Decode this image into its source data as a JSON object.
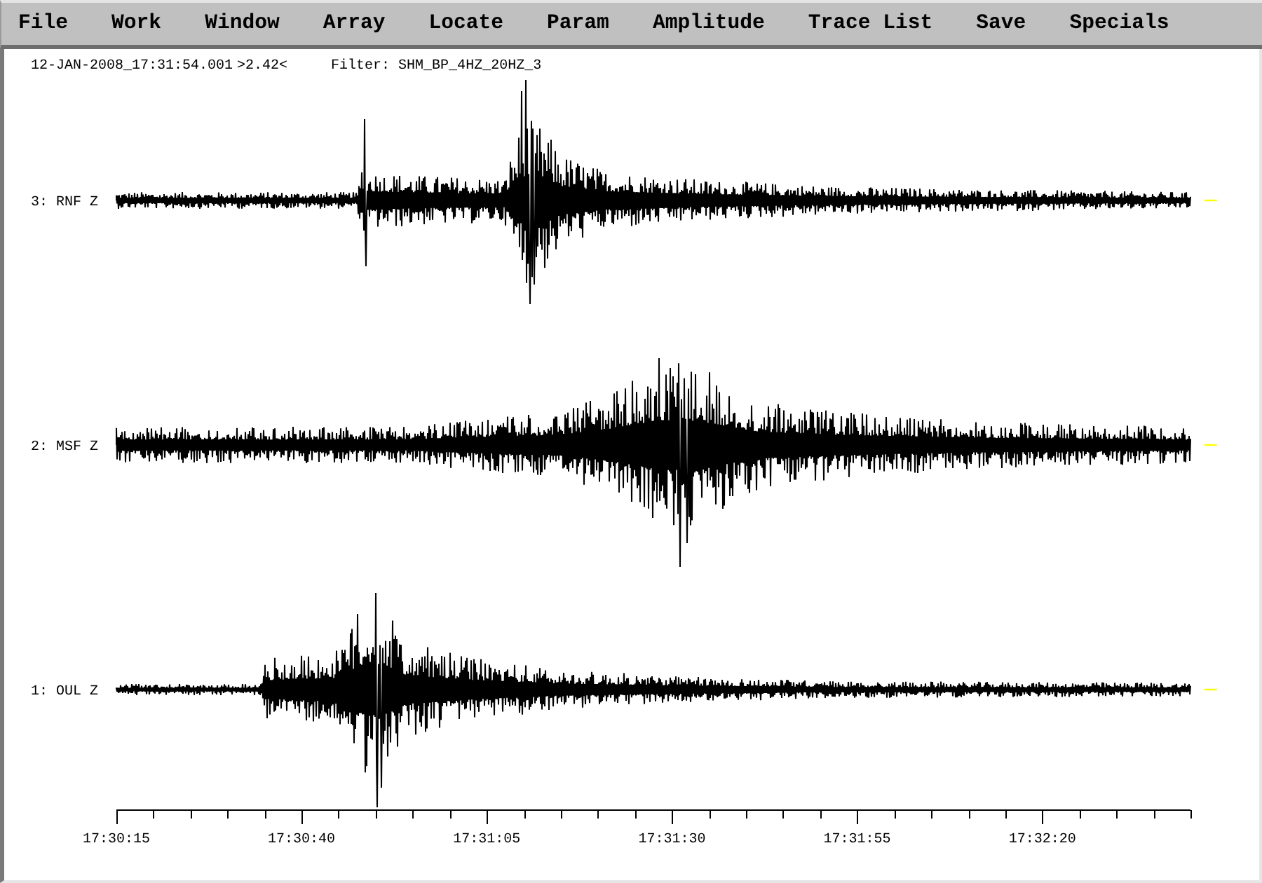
{
  "menu_bar": [
    "File",
    "Work",
    "Window",
    "Array",
    "Locate",
    "Param",
    "Amplitude",
    "Trace List",
    "Save",
    "Specials"
  ],
  "header": {
    "timestamp": "12-JAN-2008_17:31:54.001",
    "readout": ">2.42<",
    "filter": "Filter: SHM_BP_4HZ_20HZ_3"
  },
  "traces": [
    {
      "label": "3: RNF Z"
    },
    {
      "label": "2: MSF Z"
    },
    {
      "label": "1: OUL Z"
    }
  ],
  "time_axis": {
    "tick_labels": [
      "17:30:15",
      "17:30:40",
      "17:31:05",
      "17:31:30",
      "17:31:55",
      "17:32:20"
    ]
  }
}
